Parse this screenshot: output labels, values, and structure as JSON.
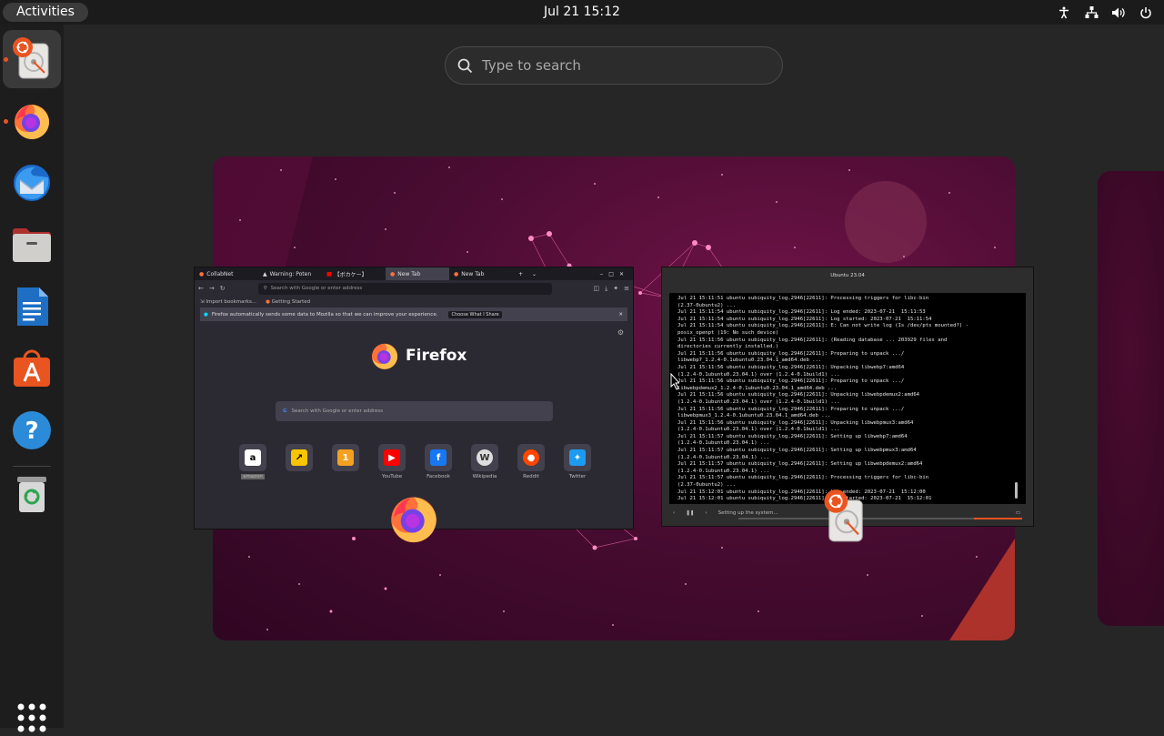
{
  "topbar": {
    "activities_label": "Activities",
    "clock": "Jul 21  15:12",
    "tray_icons": [
      "accessibility-icon",
      "network-icon",
      "volume-icon",
      "power-icon"
    ]
  },
  "dock": {
    "items": [
      {
        "name": "ubuntu-installer",
        "running": true,
        "active": true
      },
      {
        "name": "firefox",
        "running": true,
        "active": false
      },
      {
        "name": "thunderbird",
        "running": false,
        "active": false
      },
      {
        "name": "files",
        "running": false,
        "active": false
      },
      {
        "name": "libreoffice-writer",
        "running": false,
        "active": false
      },
      {
        "name": "app-center",
        "running": false,
        "active": false
      },
      {
        "name": "help",
        "running": false,
        "active": false
      },
      {
        "name": "trash",
        "running": false,
        "active": false
      }
    ],
    "show_apps_icon": "grid-icon"
  },
  "search": {
    "placeholder": "Type to search"
  },
  "firefox": {
    "tabs": [
      "CollabNet",
      "Warning: Poten",
      "【ボカケー】",
      "New Tab",
      "New Tab"
    ],
    "url_placeholder": "Search with Google or enter address",
    "bookmarks": [
      "Import bookmarks...",
      "Getting Started"
    ],
    "notice": "Firefox automatically sends some data to Mozilla so that we can improve your experience.",
    "notice_button": "Choose What I Share",
    "brand": "Firefox",
    "search_placeholder": "Search with Google or enter address",
    "shortcuts": [
      {
        "label": "amazon",
        "highlighted": true
      },
      {
        "label": "",
        "highlighted": true
      },
      {
        "label": "",
        "highlighted": true
      },
      {
        "label": "YouTube",
        "highlighted": false
      },
      {
        "label": "Facebook",
        "highlighted": false
      },
      {
        "label": "Wikipedia",
        "highlighted": false
      },
      {
        "label": "Reddit",
        "highlighted": false
      },
      {
        "label": "Twitter",
        "highlighted": false
      }
    ]
  },
  "installer": {
    "title": "Ubuntu 23.04",
    "log": "Jul 21 15:11:51 ubuntu subiquity_log.2946[22611]: Processing triggers for libc-bin\n(2.37-0ubuntu2) ...\nJul 21 15:11:54 ubuntu subiquity_log.2946[22611]: Log ended: 2023-07-21  15:11:53\nJul 21 15:11:54 ubuntu subiquity_log.2946[22611]: Log started: 2023-07-21  15:11:54\nJul 21 15:11:54 ubuntu subiquity_log.2946[22611]: E: Can not write log (Is /dev/pts mounted?) -\nposix_openpt (19: No such device)\nJul 21 15:11:56 ubuntu subiquity_log.2946[22611]: (Reading database ... 203929 files and\ndirectories currently installed.)\nJul 21 15:11:56 ubuntu subiquity_log.2946[22611]: Preparing to unpack .../\nlibwebp7_1.2.4-0.1ubuntu0.23.04.1_amd64.deb ...\nJul 21 15:11:56 ubuntu subiquity_log.2946[22611]: Unpacking libwebp7:amd64\n(1.2.4-0.1ubuntu0.23.04.1) over (1.2.4-0.1build1) ...\nJul 21 15:11:56 ubuntu subiquity_log.2946[22611]: Preparing to unpack .../\nlibwebpdemux2_1.2.4-0.1ubuntu0.23.04.1_amd64.deb ...\nJul 21 15:11:56 ubuntu subiquity_log.2946[22611]: Unpacking libwebpdemux2:amd64\n(1.2.4-0.1ubuntu0.23.04.1) over (1.2.4-0.1build1) ...\nJul 21 15:11:56 ubuntu subiquity_log.2946[22611]: Preparing to unpack .../\nlibwebpmux3_1.2.4-0.1ubuntu0.23.04.1_amd64.deb ...\nJul 21 15:11:56 ubuntu subiquity_log.2946[22611]: Unpacking libwebpmux3:amd64\n(1.2.4-0.1ubuntu0.23.04.1) over (1.2.4-0.1build1) ...\nJul 21 15:11:57 ubuntu subiquity_log.2946[22611]: Setting up libwebp7:amd64\n(1.2.4-0.1ubuntu0.23.04.1) ...\nJul 21 15:11:57 ubuntu subiquity_log.2946[22611]: Setting up libwebpmux3:amd64\n(1.2.4-0.1ubuntu0.23.04.1) ...\nJul 21 15:11:57 ubuntu subiquity_log.2946[22611]: Setting up libwebpdemux2:amd64\n(1.2.4-0.1ubuntu0.23.04.1) ...\nJul 21 15:11:57 ubuntu subiquity_log.2946[22611]: Processing triggers for libc-bin\n(2.37-0ubuntu2) ...\nJul 21 15:12:01 ubuntu subiquity_log.2946[22611]: Log ended: 2023-07-21  15:12:00\nJul 21 15:12:01 ubuntu subiquity_log.2946[22611]: Log started: 2023-07-21  15:12:01",
    "status": "Setting up the system..."
  },
  "colors": {
    "accent": "#e95420",
    "workspace": "#5a0f3c"
  }
}
